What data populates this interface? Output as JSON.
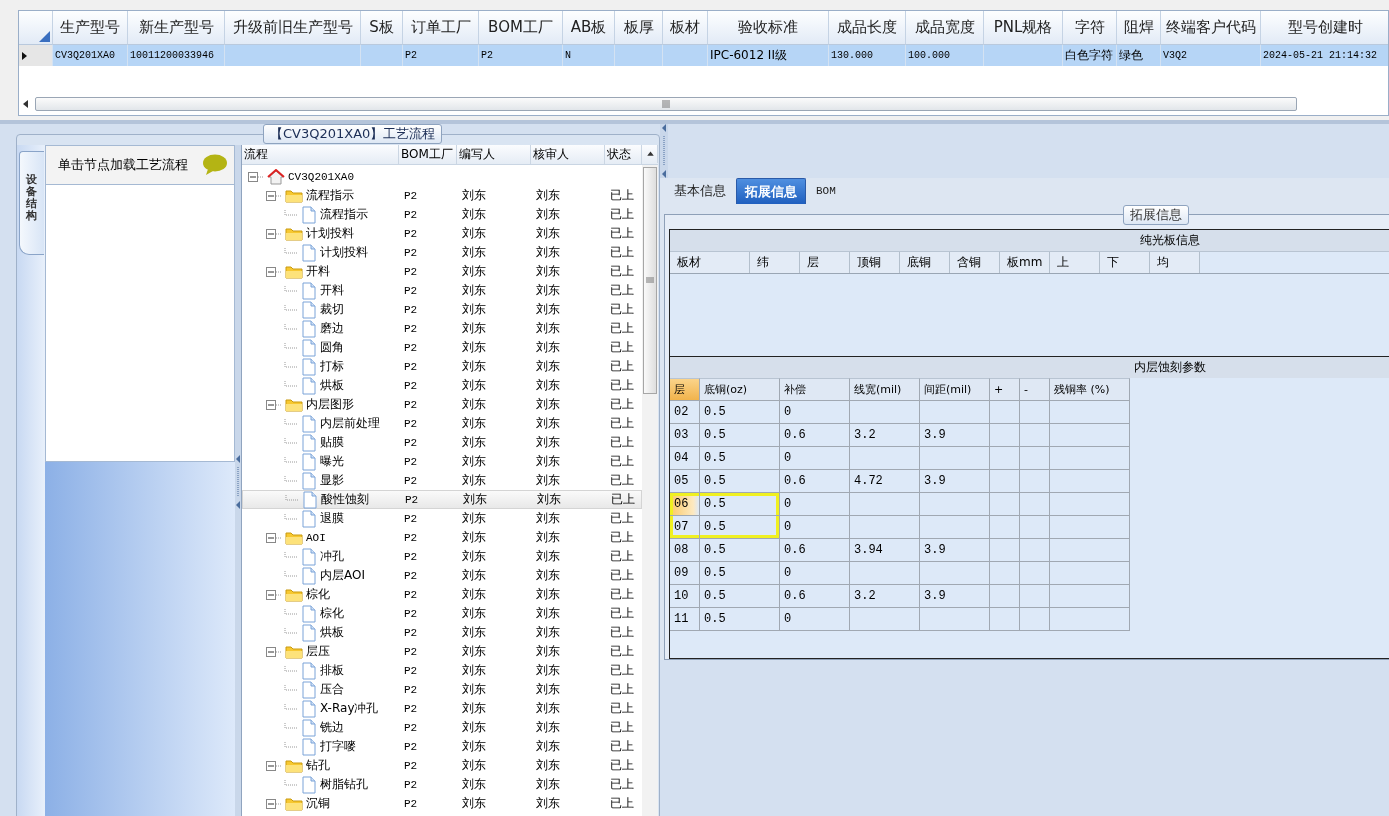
{
  "main_grid": {
    "columns": [
      "生产型号",
      "新生产型号",
      "升级前旧生产型号",
      "S板",
      "订单工厂",
      "BOM工厂",
      "AB板",
      "板厚",
      "板材",
      "验收标准",
      "成品长度",
      "成品宽度",
      "PNL规格",
      "字符",
      "阻焊",
      "终端客户代码",
      "型号创建时"
    ],
    "rows": [
      {
        "selected": true,
        "cells": [
          "CV3Q201XA0",
          "10011200033946",
          "",
          "",
          "P2",
          "P2",
          "N",
          "",
          "",
          "IPC-6012 II级",
          "130.000",
          "100.000",
          "",
          "白色字符",
          "绿色",
          "V3Q2",
          "2024-05-21 21:14:32"
        ]
      }
    ]
  },
  "flow_panel": {
    "title": "【CV3Q201XA0】工艺流程",
    "side_tab": "设备结构",
    "hint": "单击节点加载工艺流程",
    "columns": [
      "流程",
      "BOM工厂",
      "编写人",
      "核审人",
      "状态"
    ],
    "tree": [
      {
        "kind": "root",
        "label": "CV3Q201XA0",
        "expanded": true,
        "selected": false,
        "children": [
          {
            "kind": "folder",
            "label": "流程指示",
            "bom": "P2",
            "writer": "刘东",
            "reviewer": "刘东",
            "status": "已上",
            "expanded": true,
            "selected": false,
            "children": [
              {
                "kind": "doc",
                "label": "流程指示",
                "bom": "P2",
                "writer": "刘东",
                "reviewer": "刘东",
                "status": "已上",
                "selected": false
              }
            ]
          },
          {
            "kind": "folder",
            "label": "计划投料",
            "bom": "P2",
            "writer": "刘东",
            "reviewer": "刘东",
            "status": "已上",
            "expanded": true,
            "selected": false,
            "children": [
              {
                "kind": "doc",
                "label": "计划投料",
                "bom": "P2",
                "writer": "刘东",
                "reviewer": "刘东",
                "status": "已上",
                "selected": false
              }
            ]
          },
          {
            "kind": "folder",
            "label": "开料",
            "bom": "P2",
            "writer": "刘东",
            "reviewer": "刘东",
            "status": "已上",
            "expanded": true,
            "selected": false,
            "children": [
              {
                "kind": "doc",
                "label": "开料",
                "bom": "P2",
                "writer": "刘东",
                "reviewer": "刘东",
                "status": "已上",
                "selected": false
              },
              {
                "kind": "doc",
                "label": "裁切",
                "bom": "P2",
                "writer": "刘东",
                "reviewer": "刘东",
                "status": "已上",
                "selected": false
              },
              {
                "kind": "doc",
                "label": "磨边",
                "bom": "P2",
                "writer": "刘东",
                "reviewer": "刘东",
                "status": "已上",
                "selected": false
              },
              {
                "kind": "doc",
                "label": "圆角",
                "bom": "P2",
                "writer": "刘东",
                "reviewer": "刘东",
                "status": "已上",
                "selected": false
              },
              {
                "kind": "doc",
                "label": "打标",
                "bom": "P2",
                "writer": "刘东",
                "reviewer": "刘东",
                "status": "已上",
                "selected": false
              },
              {
                "kind": "doc",
                "label": "烘板",
                "bom": "P2",
                "writer": "刘东",
                "reviewer": "刘东",
                "status": "已上",
                "selected": false
              }
            ]
          },
          {
            "kind": "folder",
            "label": "内层图形",
            "bom": "P2",
            "writer": "刘东",
            "reviewer": "刘东",
            "status": "已上",
            "expanded": true,
            "selected": false,
            "children": [
              {
                "kind": "doc",
                "label": "内层前处理",
                "bom": "P2",
                "writer": "刘东",
                "reviewer": "刘东",
                "status": "已上",
                "selected": false
              },
              {
                "kind": "doc",
                "label": "贴膜",
                "bom": "P2",
                "writer": "刘东",
                "reviewer": "刘东",
                "status": "已上",
                "selected": false
              },
              {
                "kind": "doc",
                "label": "曝光",
                "bom": "P2",
                "writer": "刘东",
                "reviewer": "刘东",
                "status": "已上",
                "selected": false
              },
              {
                "kind": "doc",
                "label": "显影",
                "bom": "P2",
                "writer": "刘东",
                "reviewer": "刘东",
                "status": "已上",
                "selected": false
              },
              {
                "kind": "doc",
                "label": "酸性蚀刻",
                "bom": "P2",
                "writer": "刘东",
                "reviewer": "刘东",
                "status": "已上",
                "selected": true
              },
              {
                "kind": "doc",
                "label": "退膜",
                "bom": "P2",
                "writer": "刘东",
                "reviewer": "刘东",
                "status": "已上",
                "selected": false
              }
            ]
          },
          {
            "kind": "folder",
            "label": "AOI",
            "bom": "P2",
            "writer": "刘东",
            "reviewer": "刘东",
            "status": "已上",
            "expanded": true,
            "selected": false,
            "children": [
              {
                "kind": "doc",
                "label": "冲孔",
                "bom": "P2",
                "writer": "刘东",
                "reviewer": "刘东",
                "status": "已上",
                "selected": false
              },
              {
                "kind": "doc",
                "label": "内层AOI",
                "bom": "P2",
                "writer": "刘东",
                "reviewer": "刘东",
                "status": "已上",
                "selected": false
              }
            ]
          },
          {
            "kind": "folder",
            "label": "棕化",
            "bom": "P2",
            "writer": "刘东",
            "reviewer": "刘东",
            "status": "已上",
            "expanded": true,
            "selected": false,
            "children": [
              {
                "kind": "doc",
                "label": "棕化",
                "bom": "P2",
                "writer": "刘东",
                "reviewer": "刘东",
                "status": "已上",
                "selected": false
              },
              {
                "kind": "doc",
                "label": "烘板",
                "bom": "P2",
                "writer": "刘东",
                "reviewer": "刘东",
                "status": "已上",
                "selected": false
              }
            ]
          },
          {
            "kind": "folder",
            "label": "层压",
            "bom": "P2",
            "writer": "刘东",
            "reviewer": "刘东",
            "status": "已上",
            "expanded": true,
            "selected": false,
            "children": [
              {
                "kind": "doc",
                "label": "排板",
                "bom": "P2",
                "writer": "刘东",
                "reviewer": "刘东",
                "status": "已上",
                "selected": false
              },
              {
                "kind": "doc",
                "label": "压合",
                "bom": "P2",
                "writer": "刘东",
                "reviewer": "刘东",
                "status": "已上",
                "selected": false
              },
              {
                "kind": "doc",
                "label": "X-Ray冲孔",
                "bom": "P2",
                "writer": "刘东",
                "reviewer": "刘东",
                "status": "已上",
                "selected": false
              },
              {
                "kind": "doc",
                "label": "铣边",
                "bom": "P2",
                "writer": "刘东",
                "reviewer": "刘东",
                "status": "已上",
                "selected": false
              },
              {
                "kind": "doc",
                "label": "打字嘜",
                "bom": "P2",
                "writer": "刘东",
                "reviewer": "刘东",
                "status": "已上",
                "selected": false
              }
            ]
          },
          {
            "kind": "folder",
            "label": "钻孔",
            "bom": "P2",
            "writer": "刘东",
            "reviewer": "刘东",
            "status": "已上",
            "expanded": true,
            "selected": false,
            "children": [
              {
                "kind": "doc",
                "label": "树脂钻孔",
                "bom": "P2",
                "writer": "刘东",
                "reviewer": "刘东",
                "status": "已上",
                "selected": false
              }
            ]
          },
          {
            "kind": "folder",
            "label": "沉铜",
            "bom": "P2",
            "writer": "刘东",
            "reviewer": "刘东",
            "status": "已上",
            "expanded": true,
            "selected": false
          }
        ]
      }
    ]
  },
  "info_panel": {
    "tabs": [
      {
        "label": "基本信息",
        "selected": false
      },
      {
        "label": "拓展信息",
        "selected": true
      },
      {
        "label": "BOM",
        "selected": false
      }
    ],
    "group_title": "拓展信息",
    "plain_board": {
      "title": "纯光板信息",
      "columns": [
        "板材",
        "纬",
        "层",
        "顶铜",
        "底铜",
        "含铜",
        "板mm",
        "上",
        "下",
        "均"
      ]
    },
    "inner_etch": {
      "title": "内层蚀刻参数",
      "columns": [
        "层",
        "底铜(oz)",
        "补偿",
        "线宽(mil)",
        "间距(mil)",
        "+",
        "-",
        "残铜率 (%)"
      ],
      "rows": [
        {
          "cells": [
            "02",
            "0.5",
            "0"
          ],
          "current": false,
          "highlighted": false
        },
        {
          "cells": [
            "03",
            "0.5",
            "0.6",
            "3.2",
            "3.9"
          ],
          "current": false,
          "highlighted": false
        },
        {
          "cells": [
            "04",
            "0.5",
            "0"
          ],
          "current": false,
          "highlighted": false
        },
        {
          "cells": [
            "05",
            "0.5",
            "0.6",
            "4.72",
            "3.9"
          ],
          "current": false,
          "highlighted": false
        },
        {
          "cells": [
            "06",
            "0.5",
            "0"
          ],
          "current": true,
          "highlighted": true
        },
        {
          "cells": [
            "07",
            "0.5",
            "0"
          ],
          "current": false,
          "highlighted": true
        },
        {
          "cells": [
            "08",
            "0.5",
            "0.6",
            "3.94",
            "3.9"
          ],
          "current": false,
          "highlighted": false
        },
        {
          "cells": [
            "09",
            "0.5",
            "0"
          ],
          "current": false,
          "highlighted": false
        },
        {
          "cells": [
            "10",
            "0.5",
            "0.6",
            "3.2",
            "3.9"
          ],
          "current": false,
          "highlighted": false
        },
        {
          "cells": [
            "11",
            "0.5",
            "0"
          ],
          "current": false,
          "highlighted": false
        }
      ]
    }
  }
}
